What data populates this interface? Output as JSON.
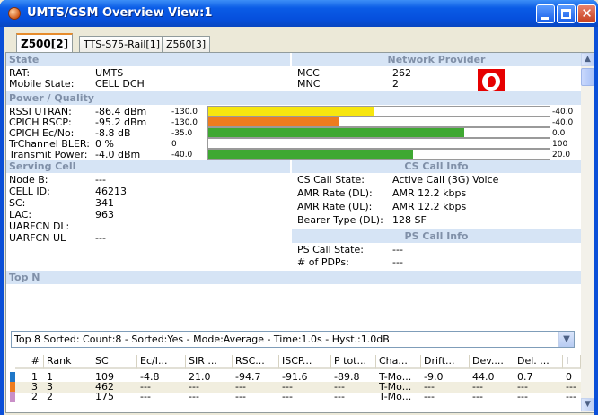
{
  "window": {
    "title": "UMTS/GSM Overview View:1",
    "colors": {
      "titlebar": "#0a5ce6",
      "close": "#c7401f"
    }
  },
  "tabs": [
    {
      "label": "Z500[2]",
      "active": true
    },
    {
      "label": "TTS-S75-Rail[1]",
      "active": false
    },
    {
      "label": "Z560[3]",
      "active": false
    }
  ],
  "state": {
    "header": "State",
    "rat_label": "RAT:",
    "rat_value": "UMTS",
    "mobile_state_label": "Mobile State:",
    "mobile_state_value": "CELL DCH"
  },
  "network_provider": {
    "header": "Network Provider",
    "mcc_label": "MCC",
    "mcc_value": "262",
    "mnc_label": "MNC",
    "mnc_value": "2",
    "logo": "vodafone-logo"
  },
  "power_quality": {
    "header": "Power / Quality",
    "rows": [
      {
        "label": "RSSI UTRAN:",
        "value": "-86.4 dBm",
        "min": "-130.0",
        "max": "-40.0",
        "fill": 0.485,
        "color": "#f7e60f"
      },
      {
        "label": "CPICH RSCP:",
        "value": "-95.2 dBm",
        "min": "-130.0",
        "max": "-40.0",
        "fill": 0.385,
        "color": "#ee7c1f"
      },
      {
        "label": "CPICH Ec/No:",
        "value": "-8.8 dB",
        "min": "-35.0",
        "max": "0.0",
        "fill": 0.75,
        "color": "#3fa832"
      },
      {
        "label": "TrChannel BLER:",
        "value": "0 %",
        "min": "0",
        "max": "100",
        "fill": 0.0,
        "color": "#3fa832"
      },
      {
        "label": "Transmit Power:",
        "value": "-4.0 dBm",
        "min": "-40.0",
        "max": "20.0",
        "fill": 0.6,
        "color": "#3fa832"
      }
    ]
  },
  "serving_cell": {
    "header": "Serving Cell",
    "rows": [
      {
        "label": "Node B:",
        "value": "---"
      },
      {
        "label": "CELL ID:",
        "value": "46213"
      },
      {
        "label": "SC:",
        "value": "341"
      },
      {
        "label": "LAC:",
        "value": "963"
      },
      {
        "label": "UARFCN DL:",
        "value": ""
      },
      {
        "label": "UARFCN UL",
        "value": "---"
      }
    ]
  },
  "cs_call": {
    "header": "CS Call Info",
    "rows": [
      {
        "label": "CS Call State:",
        "value": "Active Call (3G)  Voice"
      },
      {
        "label": "AMR Rate (DL):",
        "value": "AMR 12.2 kbps"
      },
      {
        "label": "AMR Rate (UL):",
        "value": "AMR 12.2 kbps"
      },
      {
        "label": "Bearer Type (DL):",
        "value": "128 SF"
      }
    ]
  },
  "ps_call": {
    "header": "PS Call Info",
    "rows": [
      {
        "label": "PS Call State:",
        "value": "---"
      },
      {
        "label": "# of PDPs:",
        "value": "---"
      }
    ]
  },
  "top_n": {
    "header": "Top N",
    "selected": "Top 8 Sorted: Count:8 - Sorted:Yes - Mode:Average - Time:1.0s - Hyst.:1.0dB",
    "columns": [
      "#",
      "Rank",
      "SC",
      "Ec/I...",
      "SIR ...",
      "RSC...",
      "ISCP...",
      "P tot...",
      "Cha...",
      "Drift...",
      "Dev....",
      "Del. ...",
      "I"
    ],
    "rows": [
      {
        "color": "#1f77c8",
        "cells": [
          "1",
          "1",
          "109",
          "-4.8",
          "21.0",
          "-94.7",
          "-91.6",
          "-89.8",
          "T-Mo...",
          "-9.0",
          "44.0",
          "0.7",
          "0"
        ]
      },
      {
        "color": "#ee7c1f",
        "cells": [
          "3",
          "3",
          "462",
          "---",
          "---",
          "---",
          "---",
          "---",
          "T-Mo...",
          "---",
          "---",
          "---",
          "---"
        ]
      },
      {
        "color": "#c98fc7",
        "cells": [
          "2",
          "2",
          "175",
          "---",
          "---",
          "---",
          "---",
          "---",
          "T-Mo...",
          "---",
          "---",
          "---",
          "---"
        ]
      }
    ]
  }
}
